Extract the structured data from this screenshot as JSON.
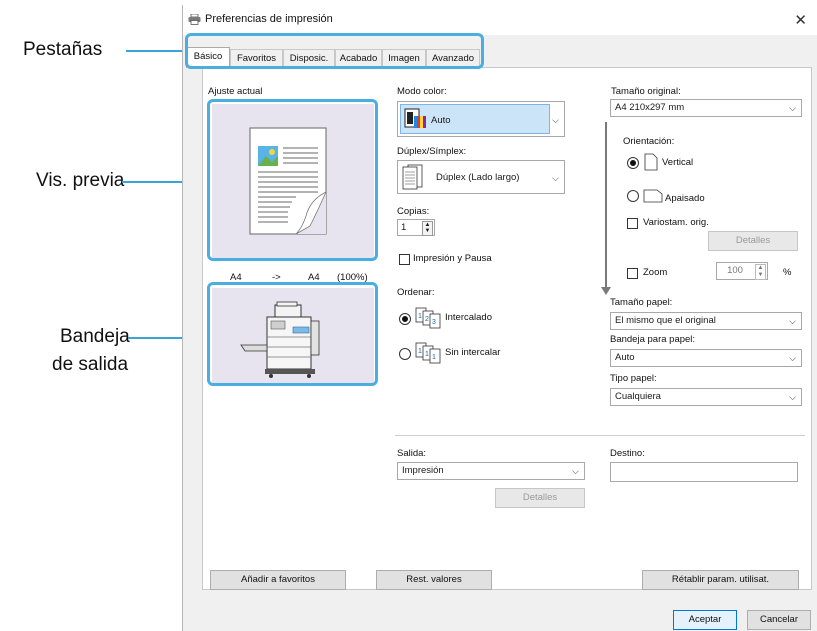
{
  "callouts": {
    "tabs": "Pestañas",
    "preview": "Vis. previa",
    "output_tray_line1": "Bandeja",
    "output_tray_line2": "de salida"
  },
  "window": {
    "title": "Preferencias de impresión",
    "close": "✕"
  },
  "tabs": [
    {
      "label": "Básico",
      "active": true
    },
    {
      "label": "Favoritos",
      "active": false
    },
    {
      "label": "Disposic.",
      "active": false
    },
    {
      "label": "Acabado",
      "active": false
    },
    {
      "label": "Imagen",
      "active": false
    },
    {
      "label": "Avanzado",
      "active": false
    }
  ],
  "left": {
    "current_setting_label": "Ajuste actual",
    "size_from": "A4",
    "arrow": "->",
    "size_to": "A4",
    "scale": "(100%)"
  },
  "middle": {
    "color_mode_label": "Modo color:",
    "color_mode_value": "Auto",
    "duplex_label": "Dúplex/Símplex:",
    "duplex_value": "Dúplex (Lado largo)",
    "copies_label": "Copias:",
    "copies_value": "1",
    "print_pause_label": "Impresión y Pausa",
    "print_pause_checked": false,
    "sort_label": "Ordenar:",
    "collated_label": "Intercalado",
    "collated_selected": true,
    "uncollated_label": "Sin intercalar",
    "uncollated_selected": false
  },
  "right": {
    "original_size_label": "Tamaño original:",
    "original_size_value": "A4 210x297 mm",
    "orientation_label": "Orientación:",
    "portrait_label": "Vertical",
    "portrait_selected": true,
    "landscape_label": "Apaisado",
    "landscape_selected": false,
    "mixed_sizes_label": "Variostam. orig.",
    "details_label": "Detalles",
    "zoom_label": "Zoom",
    "zoom_value": "100",
    "zoom_unit": "%",
    "paper_size_label": "Tamaño papel:",
    "paper_size_value": "El mismo que el original",
    "paper_tray_label": "Bandeja para papel:",
    "paper_tray_value": "Auto",
    "paper_type_label": "Tipo papel:",
    "paper_type_value": "Cualquiera"
  },
  "output": {
    "output_label": "Salida:",
    "output_value": "Impresión",
    "details_label": "Detalles",
    "destination_label": "Destino:",
    "destination_value": ""
  },
  "bottom": {
    "add_favorites": "Añadir a favoritos",
    "reset_values": "Rest. valores",
    "restore_user": "Rétablir param. utilisat."
  },
  "footer": {
    "ok": "Aceptar",
    "cancel": "Cancelar"
  },
  "colors": {
    "accent": "#4aaee0",
    "selected_field": "#cce4f7",
    "preview_bg": "#e7e4ef"
  }
}
